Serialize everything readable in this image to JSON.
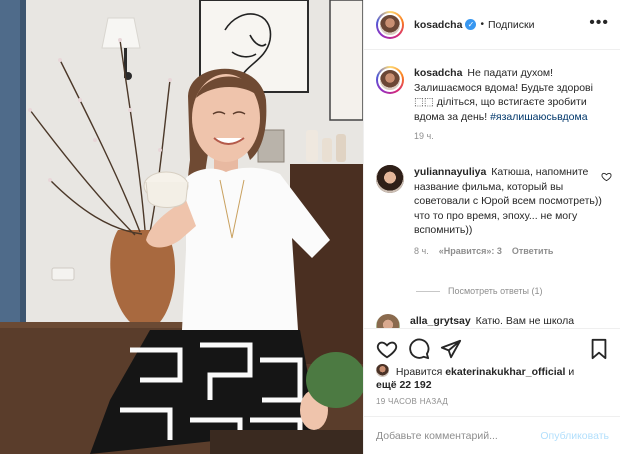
{
  "post": {
    "author": "kosadcha",
    "verified_icon": "verified-check-icon",
    "dot": "•",
    "follow_label": "Подписки",
    "more_icon": "more-options-icon"
  },
  "caption": {
    "author": "kosadcha",
    "text": "Не падати духом! Залишаємося вдома! Будьте здорові ⬚⬚ діліться, що встигаєте зробити вдома за день!",
    "hashtag": "#язалишаюсьвдома",
    "time": "19 ч."
  },
  "comment": {
    "author": "yuliannayuliya",
    "text": "Катюша, напомните название фильма, который вы советовали с Юрой всем посмотреть)) что то про время, эпоху... не могу вспомнить))",
    "time": "8 ч.",
    "likes": "«Нравится»: 3",
    "reply": "Ответить",
    "view_replies": "Посмотреть ответы (1)"
  },
  "comment2": {
    "author": "alla_grytsay",
    "text": "Катю. Вам не школа"
  },
  "likes": {
    "prefix": "Нравится",
    "user": "ekaterinakukhar_official",
    "conj": "и",
    "count": "ещё 22 192"
  },
  "timestamp": "19 ЧАСОВ НАЗАД",
  "add_comment": {
    "placeholder": "Добавьте комментарий...",
    "publish_label": "Опубликовать"
  },
  "colors": {
    "link": "#00376b",
    "verified": "#3897f0",
    "muted": "#8e8e8e",
    "publish_disabled": "#b2dffc"
  }
}
